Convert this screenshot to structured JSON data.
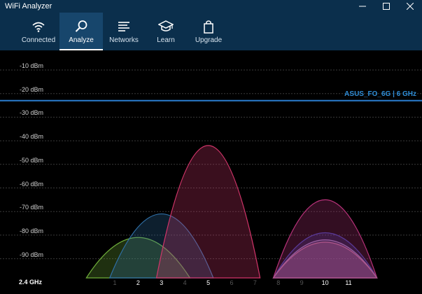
{
  "app": {
    "title": "WiFi Analyzer"
  },
  "window_controls": [
    "minimize-icon",
    "maximize-icon",
    "close-icon"
  ],
  "nav": {
    "tabs": [
      {
        "label": "Connected",
        "icon": "wifi-icon"
      },
      {
        "label": "Analyze",
        "icon": "search-icon",
        "active": true
      },
      {
        "label": "Networks",
        "icon": "list-icon"
      },
      {
        "label": "Learn",
        "icon": "graduation-cap-icon"
      },
      {
        "label": "Upgrade",
        "icon": "shopping-bag-icon"
      }
    ]
  },
  "chart": {
    "band_label": "2.4 GHz",
    "y_ticks": [
      "-10 dBm",
      "-20 dBm",
      "-30 dBm",
      "-40 dBm",
      "-50 dBm",
      "-60 dBm",
      "-70 dBm",
      "-80 dBm",
      "-90 dBm"
    ],
    "x_ticks": [
      "1",
      "2",
      "3",
      "4",
      "5",
      "6",
      "7",
      "8",
      "9",
      "10",
      "11"
    ],
    "highlight_network_label": "ASUS_FO_6G | 6 GHz"
  },
  "chart_data": {
    "type": "area",
    "x": [
      1,
      2,
      3,
      4,
      5,
      6,
      7,
      8,
      9,
      10,
      11
    ],
    "ylim": [
      -100,
      -5
    ],
    "yticks": [
      -10,
      -20,
      -30,
      -40,
      -50,
      -60,
      -70,
      -80,
      -90
    ],
    "highlight_line": {
      "y": -23,
      "color": "#2a7dd0"
    },
    "series": [
      {
        "channel": 2,
        "peak": -81,
        "color": "#6fae3a"
      },
      {
        "channel": 3,
        "peak": -71,
        "color": "#2f6fa6"
      },
      {
        "channel": 5,
        "peak": -42,
        "color": "#d2356a"
      },
      {
        "channel": 10,
        "peak": -65,
        "color": "#b8327a"
      },
      {
        "channel": 10,
        "peak": -79,
        "color": "#5a3a9a"
      },
      {
        "channel": 10,
        "peak": -82,
        "color": "#9b5fa2"
      },
      {
        "channel": 10,
        "peak": -83,
        "color": "#b0568a"
      }
    ]
  },
  "colors": {
    "nav_bg": "#0b2f4c",
    "active_tab": "#17466c",
    "accent_blue": "#2f8ed8"
  }
}
